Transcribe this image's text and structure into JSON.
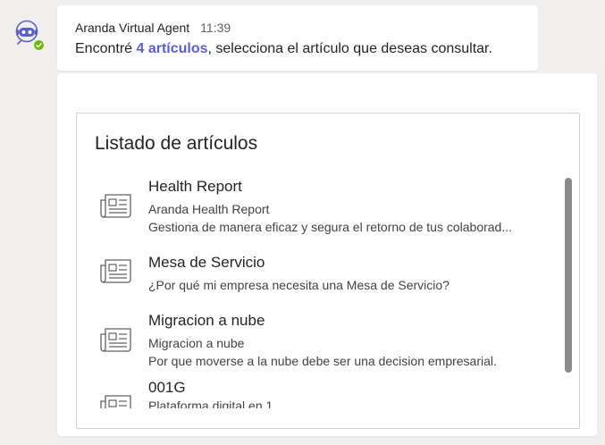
{
  "message": {
    "sender": "Aranda Virtual Agent",
    "time": "11:39",
    "text_prefix": "Encontré ",
    "text_highlight": "4 artículos",
    "text_suffix": ", selecciona el artículo que deseas consultar."
  },
  "card": {
    "title": "Listado de artículos",
    "articles": [
      {
        "title": "Health Report",
        "line1": "Aranda Health Report",
        "line2": "Gestiona de manera eficaz y segura el retorno de tus colaborad..."
      },
      {
        "title": "Mesa de Servicio",
        "line1": "¿Por qué mi empresa necesita una Mesa de Servicio?",
        "line2": ""
      },
      {
        "title": "Migracion a nube",
        "line1": "Migracion a nube",
        "line2": "Por que moverse a la nube debe ser una decision empresarial."
      },
      {
        "title": "001G",
        "line1": "Plataforma digital en 1",
        "line2": ""
      }
    ]
  },
  "icons": {
    "avatar": "bot-avatar-icon",
    "status": "available-check-icon",
    "article": "newspaper-icon"
  },
  "colors": {
    "accent": "#5b5fc7",
    "status_green": "#6bb700",
    "background": "#f0efee"
  }
}
